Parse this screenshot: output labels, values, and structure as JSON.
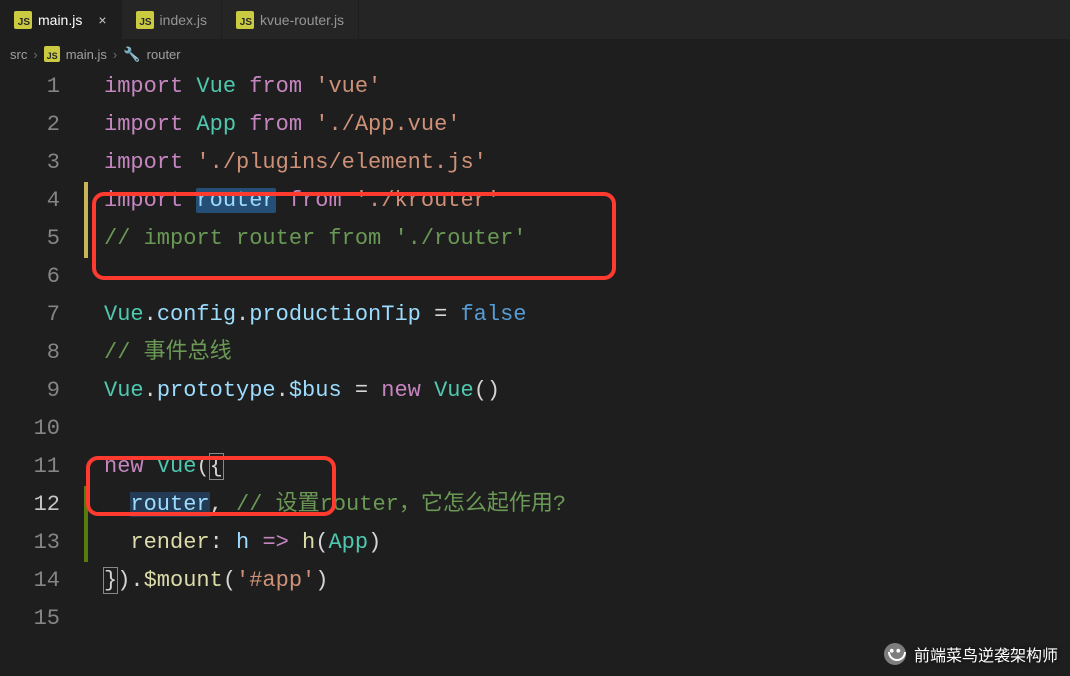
{
  "tabs": [
    {
      "label": "main.js",
      "active": true,
      "closeable": true
    },
    {
      "label": "index.js",
      "active": false,
      "closeable": false
    },
    {
      "label": "kvue-router.js",
      "active": false,
      "closeable": false
    }
  ],
  "breadcrumb": {
    "items": [
      {
        "kind": "folder",
        "text": "src"
      },
      {
        "kind": "file",
        "text": "main.js"
      },
      {
        "kind": "symbol",
        "text": "router"
      }
    ]
  },
  "code": {
    "lines": [
      {
        "n": 1,
        "tokens": [
          [
            "kw",
            "import"
          ],
          [
            "op",
            " "
          ],
          [
            "cls",
            "Vue"
          ],
          [
            "op",
            " "
          ],
          [
            "kw",
            "from"
          ],
          [
            "op",
            " "
          ],
          [
            "str",
            "'vue'"
          ]
        ]
      },
      {
        "n": 2,
        "tokens": [
          [
            "kw",
            "import"
          ],
          [
            "op",
            " "
          ],
          [
            "cls",
            "App"
          ],
          [
            "op",
            " "
          ],
          [
            "kw",
            "from"
          ],
          [
            "op",
            " "
          ],
          [
            "str",
            "'./App.vue'"
          ]
        ]
      },
      {
        "n": 3,
        "tokens": [
          [
            "kw",
            "import"
          ],
          [
            "op",
            " "
          ],
          [
            "str",
            "'./plugins/element.js'"
          ]
        ]
      },
      {
        "n": 4,
        "tokens": [
          [
            "kw",
            "import"
          ],
          [
            "op",
            " "
          ],
          [
            "var hl",
            "router"
          ],
          [
            "op",
            " "
          ],
          [
            "kw",
            "from"
          ],
          [
            "op",
            " "
          ],
          [
            "str",
            "'./krouter'"
          ]
        ]
      },
      {
        "n": 5,
        "tokens": [
          [
            "cmt",
            "// import router from './router'"
          ]
        ]
      },
      {
        "n": 6,
        "tokens": []
      },
      {
        "n": 7,
        "tokens": [
          [
            "cls",
            "Vue"
          ],
          [
            "punc",
            "."
          ],
          [
            "prop",
            "config"
          ],
          [
            "punc",
            "."
          ],
          [
            "prop",
            "productionTip"
          ],
          [
            "op",
            " = "
          ],
          [
            "lit",
            "false"
          ]
        ]
      },
      {
        "n": 8,
        "tokens": [
          [
            "cmt",
            "// 事件总线"
          ]
        ]
      },
      {
        "n": 9,
        "tokens": [
          [
            "cls",
            "Vue"
          ],
          [
            "punc",
            "."
          ],
          [
            "prop",
            "prototype"
          ],
          [
            "punc",
            "."
          ],
          [
            "prop",
            "$bus"
          ],
          [
            "op",
            " = "
          ],
          [
            "kw",
            "new"
          ],
          [
            "op",
            " "
          ],
          [
            "cls",
            "Vue"
          ],
          [
            "punc",
            "()"
          ]
        ]
      },
      {
        "n": 10,
        "tokens": []
      },
      {
        "n": 11,
        "tokens": [
          [
            "kw",
            "new"
          ],
          [
            "op",
            " "
          ],
          [
            "cls",
            "Vue"
          ],
          [
            "punc",
            "("
          ],
          [
            "punc bm",
            "{"
          ]
        ]
      },
      {
        "n": 12,
        "tokens": [
          [
            "op",
            "  "
          ],
          [
            "var sel",
            "router"
          ],
          [
            "punc",
            ","
          ],
          [
            "op",
            " "
          ],
          [
            "cmt",
            "// 设置router，它怎么起作用?"
          ]
        ],
        "active": true
      },
      {
        "n": 13,
        "tokens": [
          [
            "op",
            "  "
          ],
          [
            "func",
            "render"
          ],
          [
            "punc",
            ":"
          ],
          [
            "op",
            " "
          ],
          [
            "prm",
            "h"
          ],
          [
            "op",
            " "
          ],
          [
            "kw",
            "=>"
          ],
          [
            "op",
            " "
          ],
          [
            "func",
            "h"
          ],
          [
            "punc",
            "("
          ],
          [
            "cls",
            "App"
          ],
          [
            "punc",
            ")"
          ]
        ]
      },
      {
        "n": 14,
        "tokens": [
          [
            "punc bm",
            "}"
          ],
          [
            "punc",
            ")"
          ],
          [
            "punc",
            "."
          ],
          [
            "func",
            "$mount"
          ],
          [
            "punc",
            "("
          ],
          [
            "str",
            "'#app'"
          ],
          [
            "punc",
            ")"
          ]
        ]
      },
      {
        "n": 15,
        "tokens": []
      }
    ]
  },
  "modified_bars": {
    "yellow": [
      4,
      5
    ],
    "green": [
      12,
      13
    ]
  },
  "watermark": "前端菜鸟逆袭架构师"
}
